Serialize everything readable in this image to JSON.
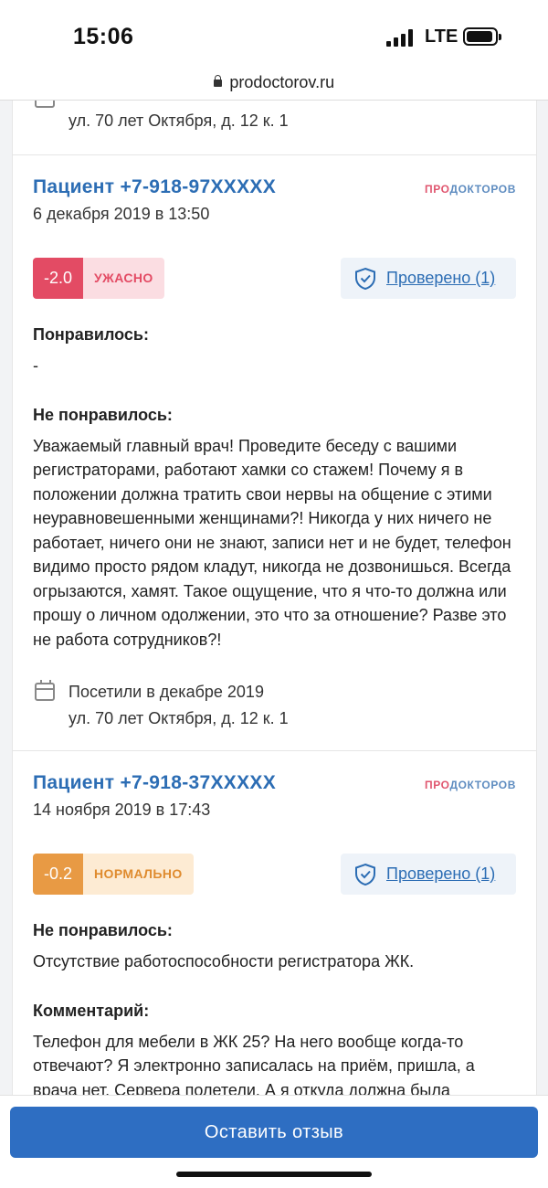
{
  "status_bar": {
    "time": "15:06",
    "network": "LTE"
  },
  "browser": {
    "url": "prodoctorov.ru"
  },
  "prev_card": {
    "address": "ул. 70 лет Октября, д. 12 к. 1"
  },
  "reviews": [
    {
      "author": "Пациент +7-918-97XXXXX",
      "date": "6 декабря 2019 в 13:50",
      "brand_pro": "ПРО",
      "brand_rest": "ДОКТОРОВ",
      "score": "-2.0",
      "rating_label": "УЖАСНО",
      "verified": "Проверено (1)",
      "liked_title": "Понравилось:",
      "liked_text": "-",
      "disliked_title": "Не понравилось:",
      "disliked_text": "Уважаемый главный врач! Проведите беседу с вашими регистраторами, работают хамки со стажем! Почему я в положении должна тратить свои нервы на общение с этими неуравновешенными женщинами?! Никогда у них ничего не работает, ничего они не знают, записи нет и не будет, телефон видимо просто рядом кладут, никогда не дозвонишься. Всегда огрызаются, хамят. Такое ощущение, что я что-то должна или прошу о личном одолжении, это что за отношение? Разве это не работа сотрудников?!",
      "visit_text": "Посетили в декабре 2019",
      "address": "ул. 70 лет Октября, д. 12 к. 1"
    },
    {
      "author": "Пациент +7-918-37XXXXX",
      "date": "14 ноября 2019 в 17:43",
      "brand_pro": "ПРО",
      "brand_rest": "ДОКТОРОВ",
      "score": "-0.2",
      "rating_label": "НОРМАЛЬНО",
      "verified": "Проверено (1)",
      "disliked_title": "Не понравилось:",
      "disliked_text": "Отсутствие работоспособности регистратора ЖК.",
      "comment_title": "Комментарий:",
      "comment_text": "Телефон для мебели в ЖК 25? На него вообще когда-то отвечают? Я электронно записалась на приём, пришла, а врача нет. Сервера полетели. А я откуда должна была"
    }
  ],
  "cta": {
    "label": "Оставить отзыв"
  },
  "colors": {
    "accent": "#2c6db4",
    "bad": "#e34b64",
    "ok": "#e89a44",
    "cta": "#2e6ec2"
  }
}
